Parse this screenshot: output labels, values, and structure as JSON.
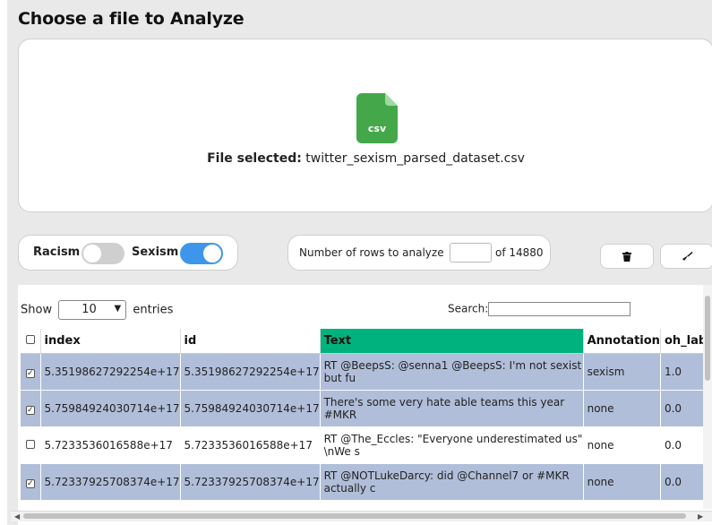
{
  "header": {
    "title": "Choose a file to Analyze"
  },
  "dropzone": {
    "icon_text": "csv",
    "file_label": "File selected:",
    "file_name": "twitter_sexism_parsed_dataset.csv"
  },
  "toggles": {
    "racism_label": "Racism",
    "racism_on": false,
    "sexism_label": "Sexism",
    "sexism_on": true
  },
  "rows": {
    "label": "Number of rows to analyze",
    "value": "",
    "total": "of 14880"
  },
  "buttons": {
    "delete_icon": "trash-icon",
    "clear_icon": "broom-icon"
  },
  "table": {
    "show_label": "Show",
    "page_size": "10",
    "entries_label": "entries",
    "search_label": "Search:",
    "columns": [
      "index",
      "id",
      "Text",
      "Annotation",
      "oh_label"
    ],
    "rows": [
      {
        "checked": true,
        "index": "5.35198627292254e+17",
        "id": "5.35198627292254e+17",
        "text": "RT @BeepsS: @senna1 @BeepsS: I'm not sexist but fu",
        "annotation": "sexism",
        "oh_label": "1.0"
      },
      {
        "checked": true,
        "index": "5.75984924030714e+17",
        "id": "5.75984924030714e+17",
        "text": "There's some very hate able teams this year #MKR",
        "annotation": "none",
        "oh_label": "0.0"
      },
      {
        "checked": false,
        "index": "5.7233536016588e+17",
        "id": "5.7233536016588e+17",
        "text": "RT @The_Eccles: \"Everyone underestimated us\" \\nWe s",
        "annotation": "none",
        "oh_label": "0.0"
      },
      {
        "checked": true,
        "index": "5.72337925708374e+17",
        "id": "5.72337925708374e+17",
        "text": "RT @NOTLukeDarcy: did @Channel7 or #MKR actually c",
        "annotation": "none",
        "oh_label": "0.0"
      }
    ]
  },
  "colors": {
    "accent": "#3d96ea",
    "text_header": "#00b37e",
    "selected_row": "#b0bed9"
  }
}
